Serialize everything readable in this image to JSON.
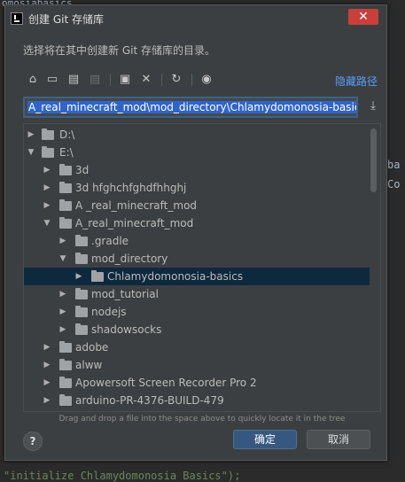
{
  "background": {
    "top_text": "omosiabasics",
    "right_lines": [
      "ba",
      "Co"
    ],
    "bottom_text": "\"initialize Chlamydomonosia Basics\");"
  },
  "dialog": {
    "title": "创建 Git 存储库",
    "close_glyph": "✕",
    "description": "选择将在其中创建新 Git 存储库的目录。",
    "toolbar": {
      "icons": [
        "home-icon",
        "desktop-icon",
        "project-icon",
        "module-icon",
        "new-folder-icon",
        "delete-icon",
        "refresh-icon",
        "show-hidden-icon"
      ],
      "hidden_path_label": "隐藏路径"
    },
    "path": {
      "value": "A_real_minecraft_mod\\mod_directory\\Chlamydomonosia-basics"
    },
    "tree": {
      "rows": [
        {
          "label": "D:\\",
          "expanded": false
        },
        {
          "label": "E:\\",
          "expanded": true
        },
        {
          "label": "3d",
          "expanded": false
        },
        {
          "label": "3d   hfghchfghdfhhghj",
          "expanded": false
        },
        {
          "label": "A _real_minecraft_mod",
          "expanded": false
        },
        {
          "label": "A_real_minecraft_mod",
          "expanded": true
        },
        {
          "label": ".gradle",
          "expanded": false
        },
        {
          "label": "mod_directory",
          "expanded": true
        },
        {
          "label": "Chlamydomonosia-basics",
          "expanded": false
        },
        {
          "label": "mod_tutorial",
          "expanded": false
        },
        {
          "label": "nodejs",
          "expanded": false
        },
        {
          "label": "shadowsocks",
          "expanded": false
        },
        {
          "label": "adobe",
          "expanded": false
        },
        {
          "label": "alww",
          "expanded": false
        },
        {
          "label": "Apowersoft Screen Recorder Pro 2",
          "expanded": false
        },
        {
          "label": "arduino-PR-4376-BUILD-479",
          "expanded": false
        }
      ]
    },
    "hint": "Drag and drop a file into the space above to quickly locate it in the tree",
    "help_label": "?",
    "ok_label": "确定",
    "cancel_label": "取消"
  }
}
